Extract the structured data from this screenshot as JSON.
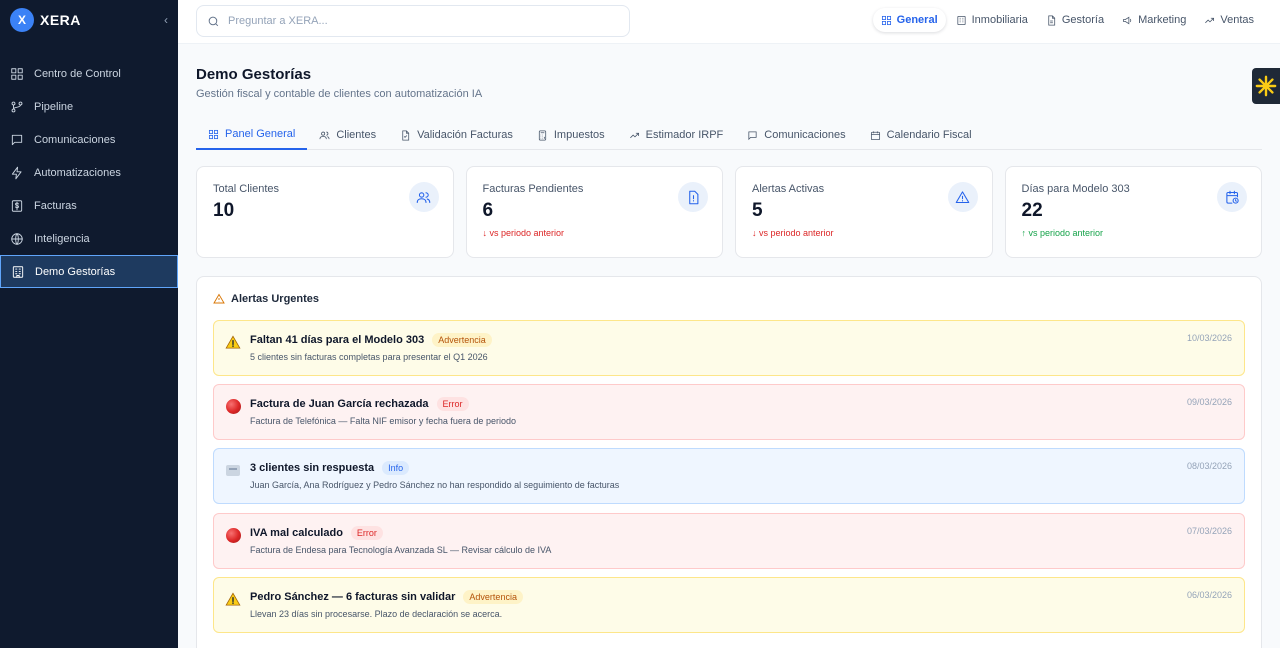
{
  "app": {
    "logo_letter": "X",
    "name": "XERA",
    "collapse_glyph": "‹"
  },
  "sidebar": {
    "items": [
      {
        "label": "Centro de Control",
        "icon": "dashboard-icon"
      },
      {
        "label": "Pipeline",
        "icon": "git-branch-icon"
      },
      {
        "label": "Comunicaciones",
        "icon": "message-square-icon"
      },
      {
        "label": "Automatizaciones",
        "icon": "zap-icon"
      },
      {
        "label": "Facturas",
        "icon": "dollar-receipt-icon"
      },
      {
        "label": "Inteligencia",
        "icon": "globe-icon"
      },
      {
        "label": "Demo Gestorías",
        "icon": "building-icon",
        "active": true
      }
    ]
  },
  "topbar": {
    "search_placeholder": "Preguntar a XERA...",
    "tabs": [
      {
        "label": "General",
        "icon": "grid-icon",
        "active": true
      },
      {
        "label": "Inmobiliaria",
        "icon": "building-icon"
      },
      {
        "label": "Gestoría",
        "icon": "file-icon"
      },
      {
        "label": "Marketing",
        "icon": "megaphone-icon"
      },
      {
        "label": "Ventas",
        "icon": "trending-up-icon"
      }
    ]
  },
  "page": {
    "title": "Demo Gestorías",
    "subtitle": "Gestión fiscal y contable de clientes con automatización IA",
    "tabs": [
      {
        "label": "Panel General",
        "icon": "grid-icon",
        "active": true
      },
      {
        "label": "Clientes",
        "icon": "users-icon"
      },
      {
        "label": "Validación Facturas",
        "icon": "file-check-icon"
      },
      {
        "label": "Impuestos",
        "icon": "calculator-icon"
      },
      {
        "label": "Estimador IRPF",
        "icon": "trending-up-icon"
      },
      {
        "label": "Comunicaciones",
        "icon": "message-square-icon"
      },
      {
        "label": "Calendario Fiscal",
        "icon": "calendar-icon"
      }
    ]
  },
  "stats": [
    {
      "label": "Total Clientes",
      "value": "10",
      "trend": "",
      "trend_dir": "",
      "icon": "users-icon"
    },
    {
      "label": "Facturas Pendientes",
      "value": "6",
      "trend": "vs periodo anterior",
      "trend_dir": "down",
      "icon": "file-alert-icon"
    },
    {
      "label": "Alertas Activas",
      "value": "5",
      "trend": "vs periodo anterior",
      "trend_dir": "down",
      "icon": "alert-triangle-icon"
    },
    {
      "label": "Días para Modelo 303",
      "value": "22",
      "trend": "vs periodo anterior",
      "trend_dir": "up",
      "icon": "calendar-clock-icon"
    }
  ],
  "alerts": {
    "heading": "Alertas Urgentes",
    "items": [
      {
        "type": "warning",
        "icon": "warning-sign-icon",
        "title": "Faltan 41 días para el Modelo 303",
        "badge": "Advertencia",
        "desc": "5 clientes sin facturas completas para presentar el Q1 2026",
        "date": "10/03/2026"
      },
      {
        "type": "error",
        "icon": "red-circle-icon",
        "title": "Factura de Juan García rechazada",
        "badge": "Error",
        "desc": "Factura de Telefónica — Falta NIF emisor y fecha fuera de periodo",
        "date": "09/03/2026"
      },
      {
        "type": "info",
        "icon": "mailbox-icon",
        "title": "3 clientes sin respuesta",
        "badge": "Info",
        "desc": "Juan García, Ana Rodríguez y Pedro Sánchez no han respondido al seguimiento de facturas",
        "date": "08/03/2026"
      },
      {
        "type": "error",
        "icon": "red-circle-icon",
        "title": "IVA mal calculado",
        "badge": "Error",
        "desc": "Factura de Endesa para Tecnología Avanzada SL — Revisar cálculo de IVA",
        "date": "07/03/2026"
      },
      {
        "type": "warning",
        "icon": "warning-sign-icon",
        "title": "Pedro Sánchez — 6 facturas sin validar",
        "badge": "Advertencia",
        "desc": "Llevan 23 días sin procesarse. Plazo de declaración se acerca.",
        "date": "06/03/2026"
      }
    ]
  },
  "colors": {
    "sidebar_bg": "#0f1a2e",
    "accent": "#2563eb",
    "error": "#dc2626",
    "success": "#16a34a",
    "warning": "#d97706"
  }
}
